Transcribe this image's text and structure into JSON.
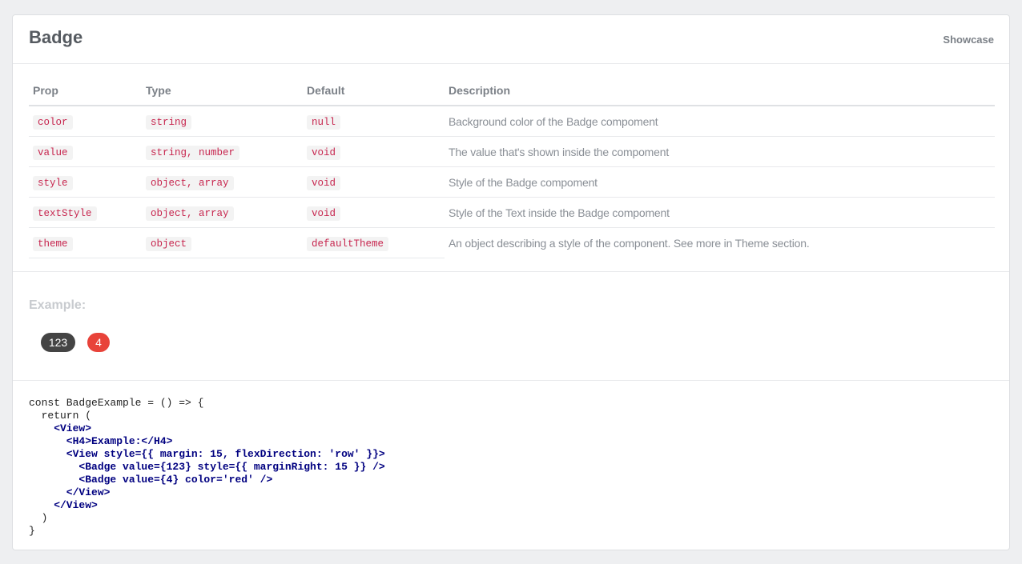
{
  "header": {
    "title": "Badge",
    "showcase_link": "Showcase"
  },
  "props_table": {
    "columns": [
      "Prop",
      "Type",
      "Default",
      "Description"
    ],
    "rows": [
      {
        "prop": "color",
        "type": "string",
        "default": "null",
        "description": "Background color of the Badge compoment"
      },
      {
        "prop": "value",
        "type": "string, number",
        "default": "void",
        "description": "The value that's shown inside the compoment"
      },
      {
        "prop": "style",
        "type": "object, array",
        "default": "void",
        "description": "Style of the Badge compoment"
      },
      {
        "prop": "textStyle",
        "type": "object, array",
        "default": "void",
        "description": "Style of the Text inside the Badge compoment"
      },
      {
        "prop": "theme",
        "type": "object",
        "default": "defaultTheme",
        "description": "An object describing a style of the component. See more in Theme section."
      }
    ]
  },
  "example": {
    "label": "Example:",
    "badges": [
      {
        "value": "123",
        "color": "#444444"
      },
      {
        "value": "4",
        "color": "#e8433a"
      }
    ]
  },
  "code": {
    "lines": [
      "const BadgeExample = () => {",
      "  return (",
      "    <View>",
      "      <H4>Example:</H4>",
      "      <View style={{ margin: 15, flexDirection: 'row' }}>",
      "        <Badge value={123} style={{ marginRight: 15 }} />",
      "        <Badge value={4} color='red' />",
      "      </View>",
      "    </View>",
      "  )",
      "}"
    ]
  }
}
